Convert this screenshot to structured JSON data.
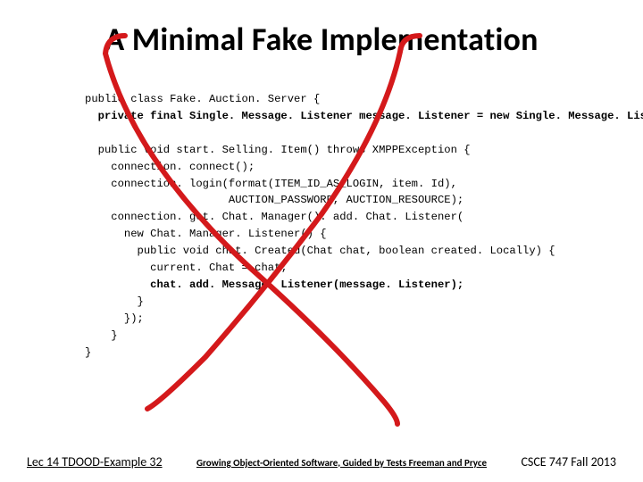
{
  "title": "A Minimal Fake Implementation",
  "code": {
    "l1": "public class Fake. Auction. Server {",
    "l2": "  private final Single. Message. Listener message. Listener = new Single. Message. Listener();",
    "l3": "",
    "l4": "  public void start. Selling. Item() throws XMPPException {",
    "l5": "    connection. connect();",
    "l6": "    connection. login(format(ITEM_ID_AS_LOGIN, item. Id),",
    "l7": "                      AUCTION_PASSWORD, AUCTION_RESOURCE);",
    "l8": "    connection. get. Chat. Manager(). add. Chat. Listener(",
    "l9": "      new Chat. Manager. Listener() {",
    "l10": "        public void chat. Created(Chat chat, boolean created. Locally) {",
    "l11": "          current. Chat = chat;",
    "l12": "          chat. add. Message. Listener(message. Listener);",
    "l13": "        }",
    "l14": "      });",
    "l15": "    }",
    "l16": "}"
  },
  "footer": {
    "left": "Lec 14 TDOOD-Example 32",
    "center": "Growing Object-Oriented Software, Guided by Tests Freeman and Pryce",
    "right": "CSCE 747 Fall 2013"
  }
}
